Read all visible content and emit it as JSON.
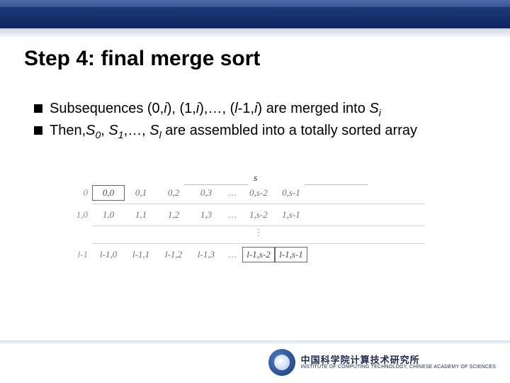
{
  "title": "Step 4: final merge sort",
  "bullets": [
    {
      "parts": [
        "Subsequences (0,",
        "i",
        "), (1,",
        "i",
        "),…, (",
        "l",
        "-1,",
        "i",
        ")  are merged into ",
        "S",
        "i"
      ]
    },
    {
      "parts": [
        "Then,",
        "S",
        "0",
        ", ",
        "S",
        "1",
        ",…, ",
        "S",
        "l",
        " are assembled into a totally sorted array"
      ]
    }
  ],
  "diagram": {
    "top_label": "s",
    "rows": [
      {
        "label": "0",
        "cells": [
          "0,0",
          "0,1",
          "0,2",
          "0,3"
        ],
        "ellipsis": "…",
        "tail": [
          "0,s-2",
          "0,s-1"
        ],
        "boxed_cols": [
          0
        ],
        "boxed_tail": []
      },
      {
        "label": "1,0",
        "cells": [
          "1,0",
          "1,1",
          "1,2",
          "1,3"
        ],
        "ellipsis": "…",
        "tail": [
          "1,s-2",
          "1,s-1"
        ],
        "boxed_cols": [],
        "boxed_tail": []
      },
      {
        "label": "l-1",
        "cells": [
          "l-1,0",
          "l-1,1",
          "l-1,2",
          "l-1,3"
        ],
        "ellipsis": "…",
        "tail": [
          "l-1,s-2",
          "l-1,s-1"
        ],
        "boxed_cols": [],
        "boxed_tail": [
          0,
          1
        ]
      }
    ],
    "vdots": "⋮"
  },
  "footer": {
    "org_cn": "中国科学院计算技术研究所",
    "org_en": "INSTITUTE OF COMPUTING TECHNOLOGY, CHINESE ACADEMY OF SCIENCES"
  }
}
